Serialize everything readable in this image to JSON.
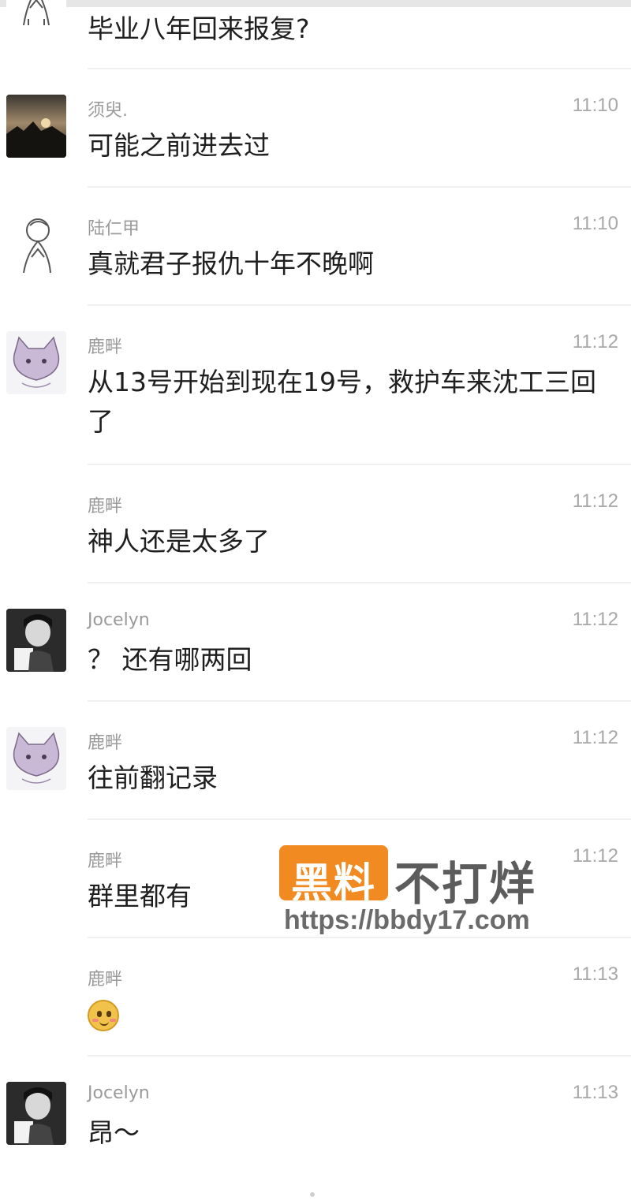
{
  "messages": [
    {
      "name": "",
      "time": "",
      "text": "毕业八年回来报复?",
      "avatar": "line-drawing-avatar"
    },
    {
      "name": "须臾.",
      "time": "11:10",
      "text": "可能之前进去过",
      "avatar": "photo-avatar"
    },
    {
      "name": "陆仁甲",
      "time": "11:10",
      "text": "真就君子报仇十年不晚啊",
      "avatar": "line-drawing-avatar"
    },
    {
      "name": "鹿畔",
      "time": "11:12",
      "text": "从13号开始到现在19号，救护车来沈工三回了",
      "avatar": "cat-avatar"
    },
    {
      "name": "鹿畔",
      "time": "11:12",
      "text": "神人还是太多了",
      "avatar": ""
    },
    {
      "name": "Jocelyn",
      "time": "11:12",
      "text": "？ 还有哪两回",
      "avatar": "bw-photo-avatar"
    },
    {
      "name": "鹿畔",
      "time": "11:12",
      "text": "往前翻记录",
      "avatar": "cat-avatar"
    },
    {
      "name": "鹿畔",
      "time": "11:12",
      "text": "群里都有",
      "avatar": ""
    },
    {
      "name": "鹿畔",
      "time": "11:13",
      "text": "",
      "avatar": "",
      "emoji": "blushing-face-emoji"
    },
    {
      "name": "Jocelyn",
      "time": "11:13",
      "text": "昂～",
      "avatar": "bw-photo-avatar"
    }
  ],
  "watermark": {
    "badge": "黑料",
    "title": "不打烊",
    "url": "https://bbdy17.com"
  }
}
